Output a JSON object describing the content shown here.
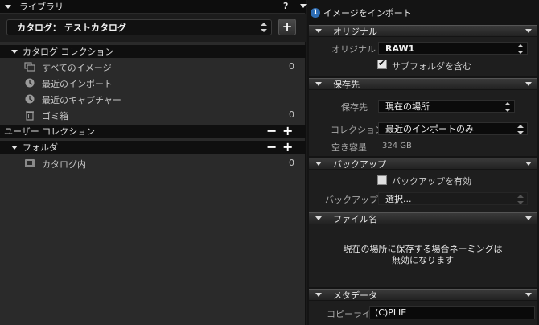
{
  "library": {
    "title": "ライブラリ",
    "help_label": "?",
    "catalog_value": "カタログ： テストカタログ",
    "add_label": "+",
    "sections": {
      "catalog_collection": "カタログ コレクション",
      "user_collection": "ユーザー コレクション",
      "folders": "フォルダ"
    },
    "minus_label": "−",
    "plus_label": "+",
    "catalog_items": [
      {
        "label": "すべてのイメージ",
        "count": "0",
        "icon": "all-images-icon"
      },
      {
        "label": "最近のインポート",
        "count": "",
        "icon": "clock-icon"
      },
      {
        "label": "最近のキャプチャー",
        "count": "",
        "icon": "clock-icon"
      },
      {
        "label": "ゴミ箱",
        "count": "0",
        "icon": "trash-icon"
      }
    ],
    "folder_items": [
      {
        "label": "カタログ内",
        "count": "0",
        "icon": "catalog-folder-icon"
      }
    ]
  },
  "import": {
    "step_number": "1",
    "title": "イメージをインポート",
    "original": {
      "header": "オリジナル",
      "field_label": "オリジナル",
      "value": "RAW1",
      "include_subfolders": "サブフォルダを含む",
      "include_subfolders_checked": true
    },
    "destination": {
      "header": "保存先",
      "dest_label": "保存先",
      "dest_value": "現在の場所",
      "collection_label": "コレクション",
      "collection_value": "最近のインポートのみ",
      "free_space_label": "空き容量",
      "free_space_value": "324 GB"
    },
    "backup": {
      "header": "バックアップ",
      "enable_label": "バックアップを有効",
      "enable_checked": false,
      "backup_label": "バックアップ",
      "backup_value": "選択..."
    },
    "filename": {
      "header": "ファイル名",
      "note_line1": "現在の場所に保存する場合ネーミングは",
      "note_line2": "無効になります"
    },
    "metadata": {
      "header": "メタデータ",
      "copyright_label": "コピーライト",
      "copyright_value": "(C)PLIE"
    }
  },
  "colors": {
    "accent_blue": "#2d6db5",
    "panel_bg": "#2a2a2a",
    "header_bg": "#0d0d0d"
  }
}
